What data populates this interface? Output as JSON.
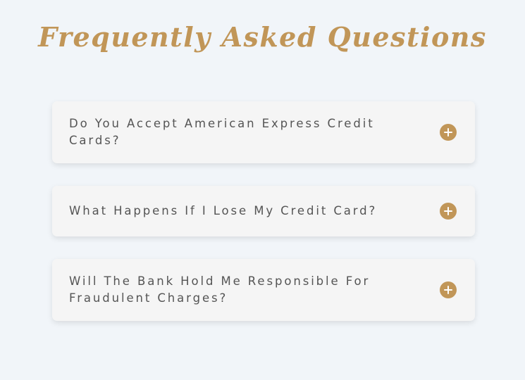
{
  "title": "Frequently Asked Questions",
  "faq": [
    {
      "question": "Do You Accept American Express Credit Cards?",
      "icon": "plus-circle-icon",
      "expanded": false
    },
    {
      "question": "What Happens If I Lose My Credit Card?",
      "icon": "plus-circle-icon",
      "expanded": false
    },
    {
      "question": "Will The Bank Hold Me Responsible For Fraudulent Charges?",
      "icon": "plus-circle-icon",
      "expanded": false
    }
  ],
  "colors": {
    "accent": "#c19658",
    "background": "#f1f5f9",
    "card": "#f5f5f5",
    "text": "#555555"
  }
}
